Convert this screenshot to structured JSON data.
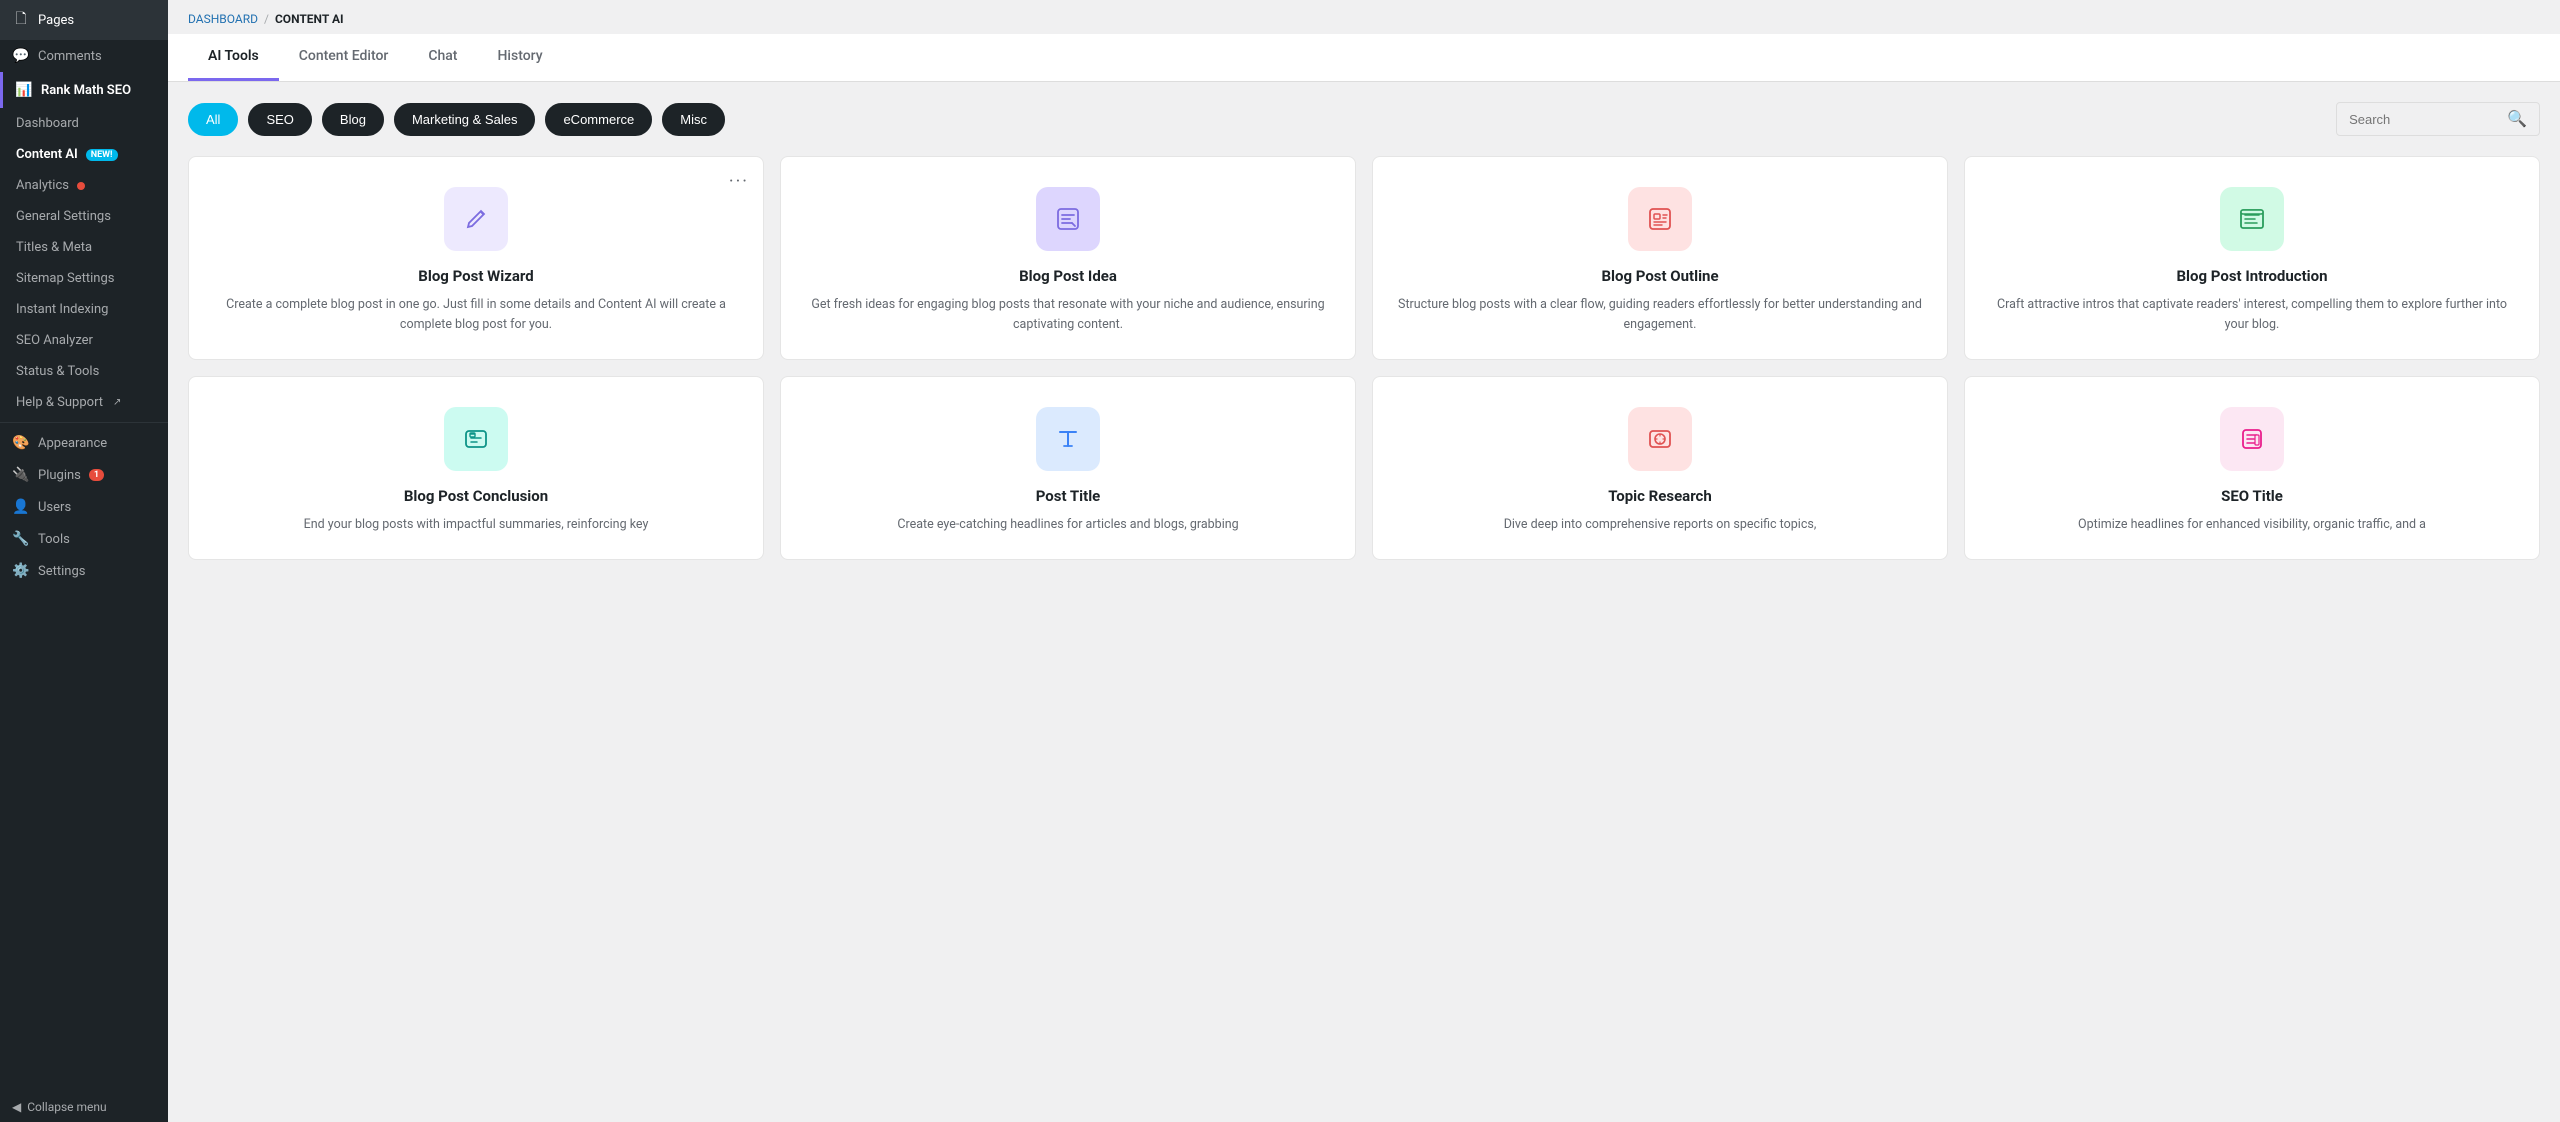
{
  "sidebar": {
    "items": [
      {
        "id": "pages",
        "label": "Pages",
        "icon": "🗋"
      },
      {
        "id": "comments",
        "label": "Comments",
        "icon": "💬"
      },
      {
        "id": "rank-math",
        "label": "Rank Math SEO",
        "icon": "📊",
        "type": "rank-math"
      },
      {
        "id": "dashboard",
        "label": "Dashboard",
        "icon": ""
      },
      {
        "id": "content-ai",
        "label": "Content AI",
        "icon": "",
        "badge": "New!",
        "type": "content-ai"
      },
      {
        "id": "analytics",
        "label": "Analytics",
        "icon": "",
        "type": "analytics"
      },
      {
        "id": "general-settings",
        "label": "General Settings",
        "icon": ""
      },
      {
        "id": "titles-meta",
        "label": "Titles & Meta",
        "icon": ""
      },
      {
        "id": "sitemap-settings",
        "label": "Sitemap Settings",
        "icon": ""
      },
      {
        "id": "instant-indexing",
        "label": "Instant Indexing",
        "icon": ""
      },
      {
        "id": "seo-analyzer",
        "label": "SEO Analyzer",
        "icon": ""
      },
      {
        "id": "status-tools",
        "label": "Status & Tools",
        "icon": ""
      },
      {
        "id": "help-support",
        "label": "Help & Support",
        "icon": ""
      },
      {
        "id": "appearance",
        "label": "Appearance",
        "icon": "🎨"
      },
      {
        "id": "plugins",
        "label": "Plugins",
        "icon": "🔌",
        "badge": "1",
        "type": "plugins"
      },
      {
        "id": "users",
        "label": "Users",
        "icon": "👤"
      },
      {
        "id": "tools",
        "label": "Tools",
        "icon": "🔧"
      },
      {
        "id": "settings",
        "label": "Settings",
        "icon": "⚙️"
      }
    ],
    "collapse_label": "Collapse menu"
  },
  "breadcrumb": {
    "dashboard": "DASHBOARD",
    "separator": "/",
    "current": "CONTENT AI"
  },
  "tabs": [
    {
      "id": "ai-tools",
      "label": "AI Tools",
      "active": true
    },
    {
      "id": "content-editor",
      "label": "Content Editor",
      "active": false
    },
    {
      "id": "chat",
      "label": "Chat",
      "active": false
    },
    {
      "id": "history",
      "label": "History",
      "active": false
    }
  ],
  "filters": [
    {
      "id": "all",
      "label": "All",
      "active": true,
      "type": "active"
    },
    {
      "id": "seo",
      "label": "SEO",
      "active": false,
      "type": "dark"
    },
    {
      "id": "blog",
      "label": "Blog",
      "active": false,
      "type": "dark"
    },
    {
      "id": "marketing",
      "label": "Marketing & Sales",
      "active": false,
      "type": "dark"
    },
    {
      "id": "ecommerce",
      "label": "eCommerce",
      "active": false,
      "type": "dark"
    },
    {
      "id": "misc",
      "label": "Misc",
      "active": false,
      "type": "dark"
    }
  ],
  "search": {
    "placeholder": "Search",
    "value": ""
  },
  "cards": [
    {
      "id": "blog-post-wizard",
      "title": "Blog Post Wizard",
      "description": "Create a complete blog post in one go. Just fill in some details and Content AI will create a complete blog post for you.",
      "icon_color": "purple-light",
      "icon_type": "pencil",
      "has_dots": true
    },
    {
      "id": "blog-post-idea",
      "title": "Blog Post Idea",
      "description": "Get fresh ideas for engaging blog posts that resonate with your niche and audience, ensuring captivating content.",
      "icon_color": "purple",
      "icon_type": "edit",
      "has_dots": false
    },
    {
      "id": "blog-post-outline",
      "title": "Blog Post Outline",
      "description": "Structure blog posts with a clear flow, guiding readers effortlessly for better understanding and engagement.",
      "icon_color": "red-light",
      "icon_type": "list",
      "has_dots": false
    },
    {
      "id": "blog-post-introduction",
      "title": "Blog Post Introduction",
      "description": "Craft attractive intros that captivate readers' interest, compelling them to explore further into your blog.",
      "icon_color": "green-light",
      "icon_type": "monitor",
      "has_dots": false
    },
    {
      "id": "blog-post-conclusion",
      "title": "Blog Post Conclusion",
      "description": "End your blog posts with impactful summaries, reinforcing key",
      "icon_color": "teal-light",
      "icon_type": "chat-list",
      "has_dots": false
    },
    {
      "id": "post-title",
      "title": "Post Title",
      "description": "Create eye-catching headlines for articles and blogs, grabbing",
      "icon_color": "blue-light",
      "icon_type": "text-cursor",
      "has_dots": false
    },
    {
      "id": "topic-research",
      "title": "Topic Research",
      "description": "Dive deep into comprehensive reports on specific topics,",
      "icon_color": "red-light",
      "icon_type": "eye-scan",
      "has_dots": false
    },
    {
      "id": "seo-title",
      "title": "SEO Title",
      "description": "Optimize headlines for enhanced visibility, organic traffic, and a",
      "icon_color": "pink-light",
      "icon_type": "doc-list",
      "has_dots": false
    }
  ]
}
